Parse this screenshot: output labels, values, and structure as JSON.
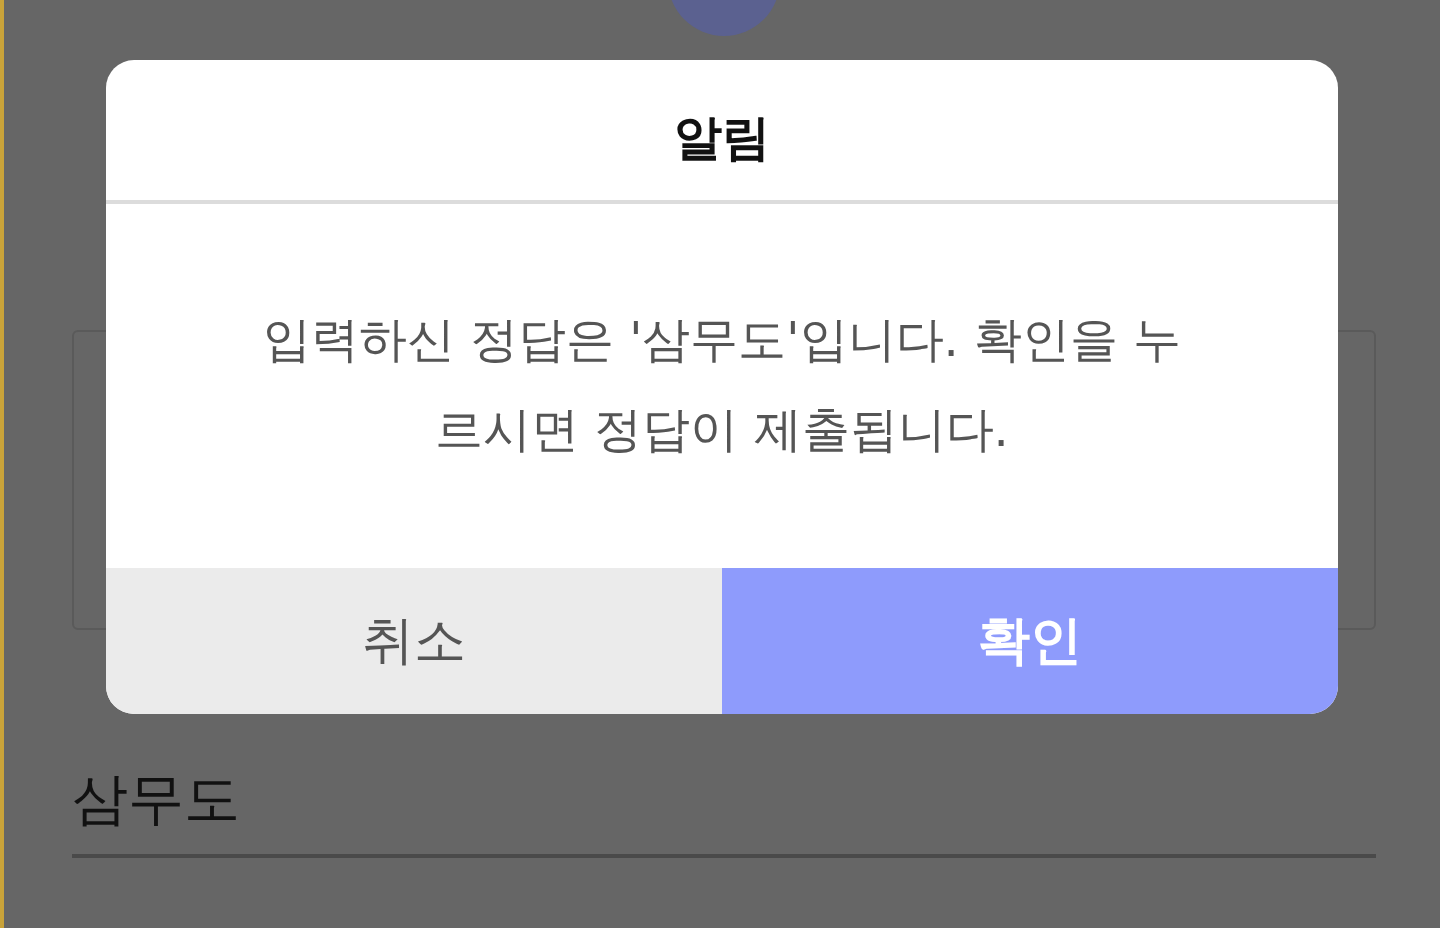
{
  "answer_field": {
    "value": "삼무도"
  },
  "dialog": {
    "title": "알림",
    "message": "입력하신 정답은 '삼무도'입니다. 확인을 누르시면 정답이 제출됩니다.",
    "buttons": [
      {
        "label": "취소",
        "kind": "cancel"
      },
      {
        "label": "확인",
        "kind": "confirm"
      }
    ]
  }
}
